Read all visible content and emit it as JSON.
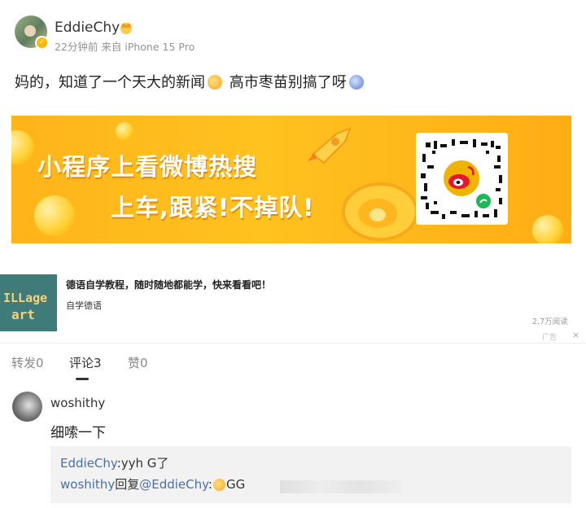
{
  "post": {
    "username": "EddieChy",
    "meta": "22分钟前 来自 iPhone 15 Pro",
    "text_part1": "妈的，知道了一个天大的新闻",
    "text_part2": "高市枣苗别搞了呀",
    "icons": [
      "verified-icon",
      "crown-icon",
      "emoji-laugh-icon",
      "emoji-cry-icon"
    ]
  },
  "banner": {
    "line1": "小程序上看微博热搜",
    "line2": "上车,跟紧!不掉队!",
    "colors": {
      "bg": "#ffbf1f",
      "text": "#ffffff"
    }
  },
  "ad": {
    "thumb_text": [
      "ILLage",
      "art"
    ],
    "title": "德语自学教程，随时随地都能学，快来看看吧！",
    "subtitle": "自学德语",
    "reads": "2.7万阅读",
    "ad_label": "广告",
    "close": "×"
  },
  "tabs": [
    {
      "label": "转发0"
    },
    {
      "label": "评论3"
    },
    {
      "label": "赞0"
    }
  ],
  "comment": {
    "username": "woshithy",
    "text": "细嗦一下",
    "reply1_user": "EddieChy",
    "reply1_text": ":yyh G了",
    "reply2_user": "woshithy",
    "reply2_mid": "回复",
    "reply2_mention": "@EddieChy",
    "reply2_text": ":",
    "reply2_tail": "GG"
  }
}
